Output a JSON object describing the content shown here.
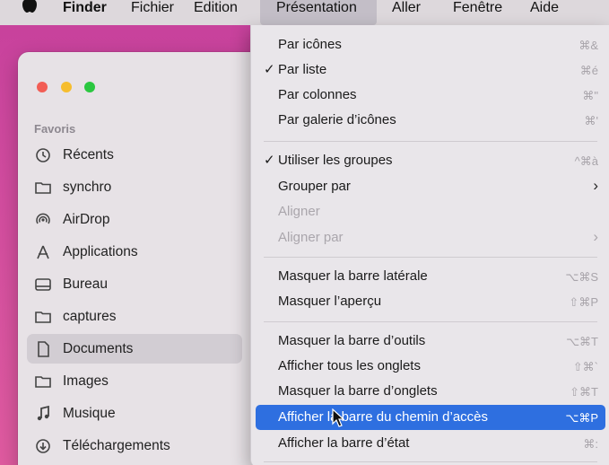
{
  "menubar": {
    "finder": "Finder",
    "fichier": "Fichier",
    "edition": "Edition",
    "presentation": "Présentation",
    "aller": "Aller",
    "fenetre": "Fenêtre",
    "aide": "Aide"
  },
  "sidebar": {
    "section": "Favoris",
    "items": [
      {
        "label": "Récents",
        "icon": "clock-icon"
      },
      {
        "label": "synchro",
        "icon": "folder-icon"
      },
      {
        "label": "AirDrop",
        "icon": "airdrop-icon"
      },
      {
        "label": "Applications",
        "icon": "applications-icon"
      },
      {
        "label": "Bureau",
        "icon": "desktop-icon"
      },
      {
        "label": "captures",
        "icon": "folder-icon"
      },
      {
        "label": "Documents",
        "icon": "document-icon"
      },
      {
        "label": "Images",
        "icon": "folder-icon"
      },
      {
        "label": "Musique",
        "icon": "music-note-icon"
      },
      {
        "label": "Téléchargements",
        "icon": "download-icon"
      }
    ],
    "selected": "Documents"
  },
  "menu": {
    "items": [
      {
        "label": "Par icônes",
        "shortcut": "⌘&"
      },
      {
        "label": "Par liste",
        "shortcut": "⌘é",
        "checked": "✓"
      },
      {
        "label": "Par colonnes",
        "shortcut": "⌘\""
      },
      {
        "label": "Par galerie d’icônes",
        "shortcut": "⌘'"
      },
      {
        "label": "Utiliser les groupes",
        "shortcut": "^⌘à",
        "checked": "✓"
      },
      {
        "label": "Grouper par",
        "shortcut": "›"
      },
      {
        "label": "Aligner",
        "shortcut": ""
      },
      {
        "label": "Aligner par",
        "shortcut": "›"
      },
      {
        "label": "Masquer la barre latérale",
        "shortcut": "⌥⌘S"
      },
      {
        "label": "Masquer l’aperçu",
        "shortcut": "⇧⌘P"
      },
      {
        "label": "Masquer la barre d’outils",
        "shortcut": "⌥⌘T"
      },
      {
        "label": "Afficher tous les onglets",
        "shortcut": "⇧⌘`"
      },
      {
        "label": "Masquer la barre d’onglets",
        "shortcut": "⇧⌘T"
      },
      {
        "label": "Afficher la barre du chemin d’accès",
        "shortcut": "⌥⌘P"
      },
      {
        "label": "Afficher la barre d’état",
        "shortcut": "⌘:"
      }
    ],
    "highlight_color": "#2e6fe0"
  }
}
